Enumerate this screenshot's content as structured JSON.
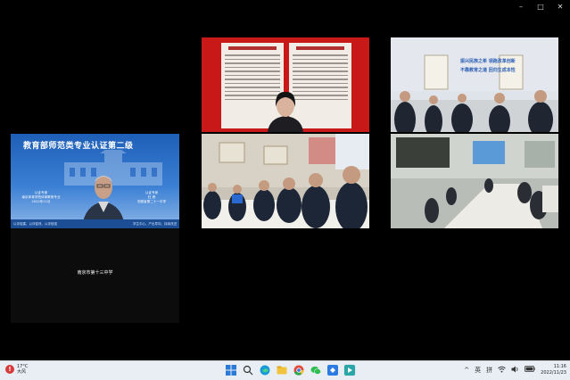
{
  "window_controls": [
    "–",
    "□",
    "✕"
  ],
  "main_tile": {
    "heading": "教育部师范类专业认证第二级",
    "left_info": [
      "认证专家",
      "南京体育学院体育教育专业",
      "2022年11月"
    ],
    "right_info": [
      "认证专家",
      "杜 睿",
      "安徽省第二十一中学"
    ],
    "strip_left": "以评促建、以评促改、以评促强",
    "strip_right": "学生中心、产出导向、持续改进",
    "caption": "南京市第十三中学"
  },
  "room_top": {
    "board_lines": [
      "振兴民族之希 领跑改革创新",
      "不靠教育之道 回归生成本性"
    ]
  },
  "taskbar": {
    "temperature": "17°C",
    "weather": "大风",
    "apps": [
      "windows-start-icon",
      "search-icon",
      "edge-browser-icon",
      "file-explorer-icon",
      "chrome-browser-icon",
      "wechat-icon",
      "tencent-meeting-icon",
      "media-app-icon"
    ],
    "tray_chevron": "^",
    "ime_lang": "英",
    "ime_mode": "拼",
    "time": "11:16",
    "date": "2022/11/23"
  },
  "colors": {
    "banner_blue": "#1e5fb8",
    "doc_red": "#c81818",
    "taskbar_bg": "#e9eef4"
  }
}
